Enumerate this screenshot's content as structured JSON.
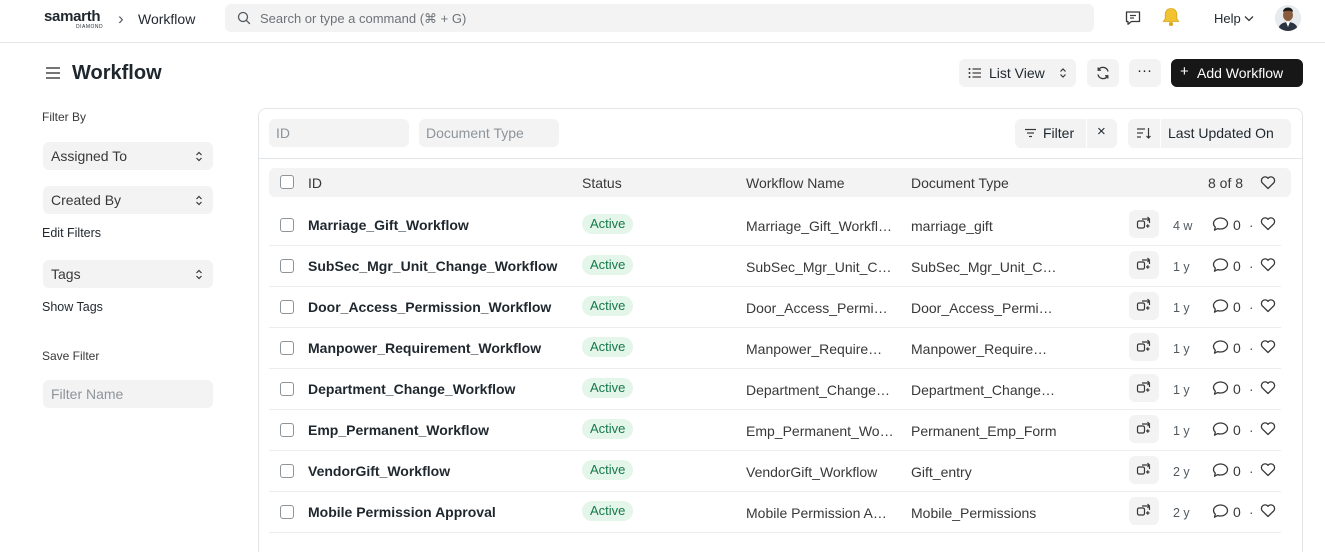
{
  "navbar": {
    "logo_text": "samarth",
    "logo_sub": "DIAMOND",
    "breadcrumb_sep": "›",
    "breadcrumb": "Workflow",
    "search_placeholder": "Search or type a command (⌘ + G)",
    "help_label": "Help"
  },
  "page": {
    "title": "Workflow",
    "list_view_label": "List View",
    "more_label": "···",
    "add_label": "Add Workflow"
  },
  "sidebar": {
    "filter_by_label": "Filter By",
    "assigned_to_label": "Assigned To",
    "created_by_label": "Created By",
    "edit_filters_label": "Edit Filters",
    "tags_label": "Tags",
    "show_tags_label": "Show Tags",
    "save_filter_label": "Save Filter",
    "filter_name_placeholder": "Filter Name"
  },
  "filters": {
    "id_placeholder": "ID",
    "doctype_placeholder": "Document Type",
    "filter_label": "Filter",
    "clear_label": "×",
    "sort_label": "Last Updated On"
  },
  "table": {
    "headers": {
      "id": "ID",
      "status": "Status",
      "workflow_name": "Workflow Name",
      "document_type": "Document Type",
      "count": "8 of 8"
    },
    "comment_sep": "·",
    "rows": [
      {
        "id": "Marriage_Gift_Workflow",
        "status": "Active",
        "workflow_name": "Marriage_Gift_Workfl…",
        "document_type": "marriage_gift",
        "ago": "4 w",
        "comments": "0"
      },
      {
        "id": "SubSec_Mgr_Unit_Change_Workflow",
        "status": "Active",
        "workflow_name": "SubSec_Mgr_Unit_C…",
        "document_type": "SubSec_Mgr_Unit_C…",
        "ago": "1 y",
        "comments": "0"
      },
      {
        "id": "Door_Access_Permission_Workflow",
        "status": "Active",
        "workflow_name": "Door_Access_Permi…",
        "document_type": "Door_Access_Permi…",
        "ago": "1 y",
        "comments": "0"
      },
      {
        "id": "Manpower_Requirement_Workflow",
        "status": "Active",
        "workflow_name": "Manpower_Require…",
        "document_type": "Manpower_Require…",
        "ago": "1 y",
        "comments": "0"
      },
      {
        "id": "Department_Change_Workflow",
        "status": "Active",
        "workflow_name": "Department_Change…",
        "document_type": "Department_Change…",
        "ago": "1 y",
        "comments": "0"
      },
      {
        "id": "Emp_Permanent_Workflow",
        "status": "Active",
        "workflow_name": "Emp_Permanent_Wo…",
        "document_type": "Permanent_Emp_Form",
        "ago": "1 y",
        "comments": "0"
      },
      {
        "id": "VendorGift_Workflow",
        "status": "Active",
        "workflow_name": "VendorGift_Workflow",
        "document_type": "Gift_entry",
        "ago": "2 y",
        "comments": "0"
      },
      {
        "id": "Mobile Permission Approval",
        "status": "Active",
        "workflow_name": "Mobile Permission A…",
        "document_type": "Mobile_Permissions",
        "ago": "2 y",
        "comments": "0"
      }
    ]
  },
  "colors": {
    "badge_bg": "#e4f5e9",
    "badge_text": "#16794c",
    "primary_button": "#171717",
    "control_bg": "#f3f3f3"
  }
}
